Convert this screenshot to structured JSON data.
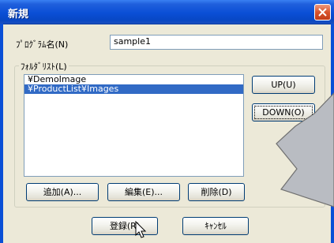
{
  "window": {
    "title": "新規",
    "close_icon": "close-icon"
  },
  "program_name": {
    "label": "ﾌﾟﾛｸﾞﾗﾑ名(N)",
    "value": "sample1"
  },
  "folder_list": {
    "label": "ﾌｫﾙﾀﾞﾘｽﾄ(L)",
    "items": [
      "¥DemoImage",
      "¥ProductList¥Images"
    ],
    "selected_index": 1
  },
  "buttons": {
    "up": "UP(U)",
    "down": "DOWN(O)",
    "add": "追加(A)...",
    "edit": "編集(E)...",
    "delete": "削除(D)",
    "register": "登録(R)",
    "cancel": "ｷｬﾝｾﾙ"
  },
  "colors": {
    "titlebar": "#0a4fd6",
    "selection": "#316ac5",
    "arrow_fill": "#b9bcc2"
  }
}
